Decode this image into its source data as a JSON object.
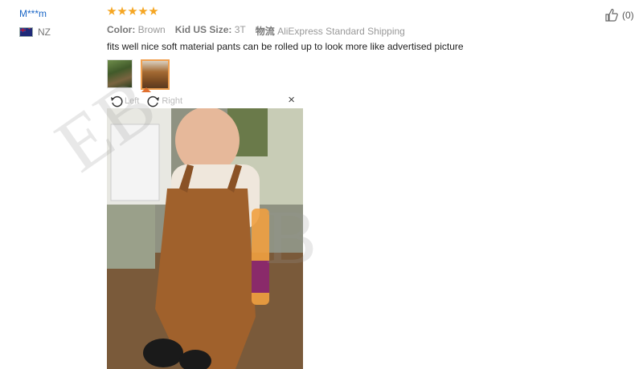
{
  "reviewer": {
    "name": "M***m",
    "country": "NZ",
    "rating": 5
  },
  "attributes": [
    {
      "label": "Color:",
      "value": "Brown"
    },
    {
      "label": "Kid US Size:",
      "value": "3T"
    },
    {
      "label": "物流",
      "value": "AliExpress Standard Shipping"
    }
  ],
  "review_text": "fits well nice soft material pants can be rolled up to look more like advertised picture",
  "viewer": {
    "rotate_left_label": "Left",
    "rotate_right_label": "Right",
    "close_label": "×"
  },
  "helpful": {
    "count": "(0)"
  },
  "watermark": {
    "text1": "EB",
    "text2": "B"
  },
  "colors": {
    "username": "#1a66c6",
    "star": "#f5a623",
    "active_thumb_border": "#f0a050"
  }
}
